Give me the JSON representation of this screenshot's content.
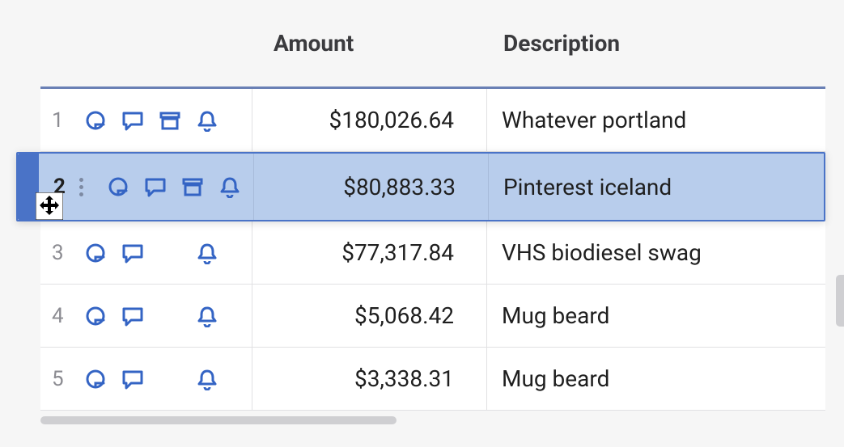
{
  "columns": {
    "amount": "Amount",
    "description": "Description"
  },
  "rows": [
    {
      "num": "1",
      "amount": "$180,026.64",
      "description": "Whatever portland",
      "selected": false,
      "icons": [
        "attach",
        "comment",
        "archive",
        "bell"
      ]
    },
    {
      "num": "2",
      "amount": "$80,883.33",
      "description": "Pinterest iceland",
      "selected": true,
      "icons": [
        "attach",
        "comment",
        "archive",
        "bell"
      ]
    },
    {
      "num": "3",
      "amount": "$77,317.84",
      "description": "VHS biodiesel swag",
      "selected": false,
      "icons": [
        "attach",
        "comment",
        "",
        "bell"
      ]
    },
    {
      "num": "4",
      "amount": "$5,068.42",
      "description": "Mug beard",
      "selected": false,
      "icons": [
        "attach",
        "comment",
        "",
        "bell"
      ]
    },
    {
      "num": "5",
      "amount": "$3,338.31",
      "description": "Mug beard",
      "selected": false,
      "icons": [
        "attach",
        "comment",
        "",
        "bell"
      ]
    }
  ]
}
